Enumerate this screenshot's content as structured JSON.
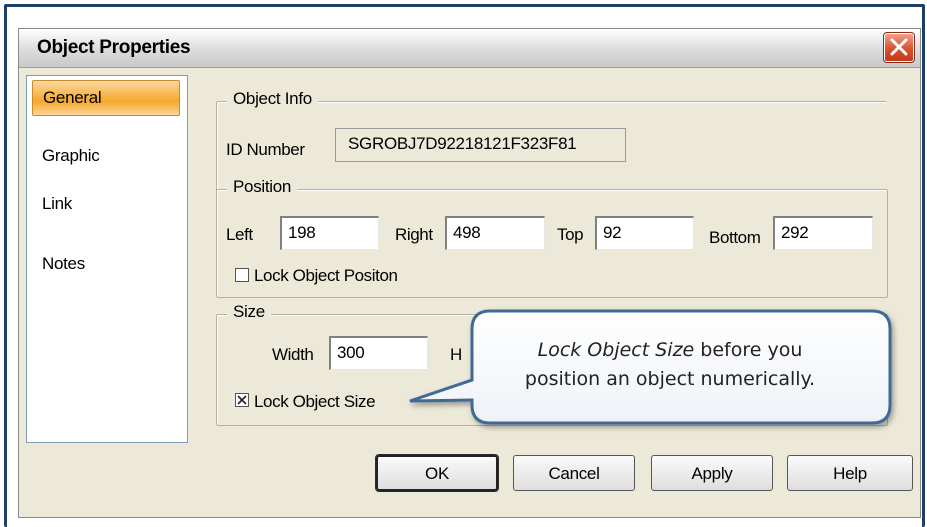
{
  "dialog": {
    "title": "Object Properties"
  },
  "sidebar": {
    "items": [
      {
        "label": "General",
        "active": true
      },
      {
        "label": "Graphic"
      },
      {
        "label": "Link"
      },
      {
        "label": "Notes"
      }
    ]
  },
  "object_info": {
    "legend": "Object Info",
    "id_label": "ID Number",
    "id_value": "SGROBJ7D92218121F323F81"
  },
  "position": {
    "legend": "Position",
    "left_label": "Left",
    "left_value": "198",
    "right_label": "Right",
    "right_value": "498",
    "top_label": "Top",
    "top_value": "92",
    "bottom_label": "Bottom",
    "bottom_value": "292",
    "lock_label": "Lock Object Positon",
    "lock_checked": false
  },
  "size": {
    "legend": "Size",
    "width_label": "Width",
    "width_value": "300",
    "height_label_partial": "H",
    "lock_label": "Lock Object Size",
    "lock_checked": true
  },
  "buttons": {
    "ok": "OK",
    "cancel": "Cancel",
    "apply": "Apply",
    "help": "Help"
  },
  "callout": {
    "emphasis": "Lock Object Size",
    "line1_rest": " before you",
    "line2": "position an object numerically."
  },
  "colors": {
    "outer_frame": "#1f3f66",
    "dialog_bg": "#ece9d8",
    "active_tab": "#f7b347",
    "close_button": "#d9512f",
    "callout_border": "#3f6a96"
  }
}
